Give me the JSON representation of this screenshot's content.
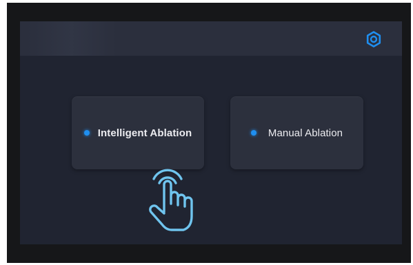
{
  "header": {
    "settings_icon": "gear-icon",
    "accent_color": "#1f8ff0"
  },
  "modes": [
    {
      "label": "Intelligent Ablation",
      "indicator_color": "#1f8ff0"
    },
    {
      "label": "Manual Ablation",
      "indicator_color": "#1f8ff0"
    }
  ],
  "pointer_icon": "tap-hand-icon",
  "colors": {
    "device_bezel": "#161719",
    "screen_background": "#202431",
    "topbar_background": "#2b2f3d",
    "card_background": "#2c303d",
    "card_text": "#ececf0",
    "hand_stroke": "#6fc4ee"
  }
}
